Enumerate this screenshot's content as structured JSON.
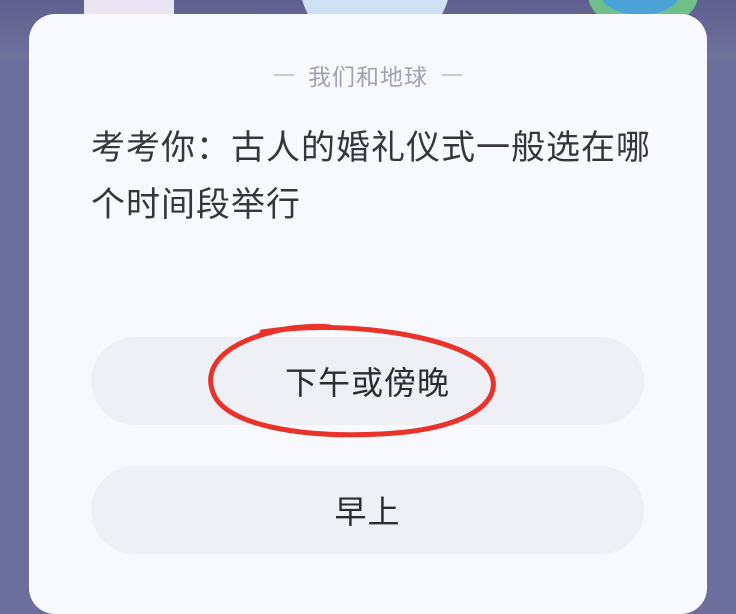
{
  "card": {
    "subtitle": "我们和地球",
    "question": "考考你：古人的婚礼仪式一般选在哪个时间段举行"
  },
  "options": [
    {
      "label": "下午或傍晚",
      "highlighted": true
    },
    {
      "label": "早上",
      "highlighted": false
    }
  ],
  "colors": {
    "highlight_mark": "#e8322a",
    "card_background": "#f8f9fc",
    "option_background": "#eef0f5"
  }
}
